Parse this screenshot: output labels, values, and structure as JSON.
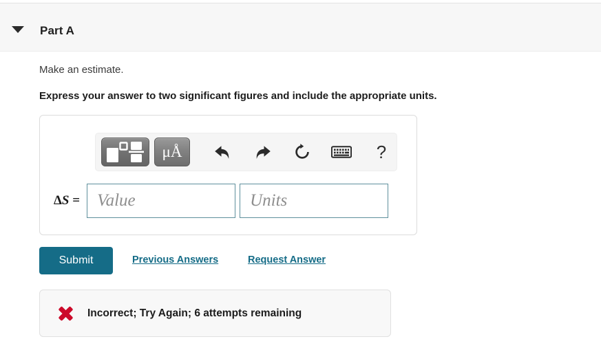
{
  "part": {
    "title": "Part A",
    "disclosure_icon": "caret-down-icon",
    "expanded": true
  },
  "question": {
    "prompt": "Make an estimate.",
    "instruction": "Express your answer to two significant figures and include the appropriate units."
  },
  "toolbar": {
    "template_button": {
      "icon": "math-template-icon",
      "tooltip": "Templates"
    },
    "units_button": {
      "label": "μÅ",
      "icon": "units-icon"
    },
    "undo_button": {
      "icon": "undo-arrow-icon"
    },
    "redo_button": {
      "icon": "redo-arrow-icon"
    },
    "reset_button": {
      "icon": "reset-circular-arrow-icon"
    },
    "keyboard_button": {
      "icon": "keyboard-icon"
    },
    "help_button": {
      "label": "?",
      "icon": "question-mark-icon"
    }
  },
  "answer": {
    "variable_symbol": "ΔS",
    "equals_sign": "=",
    "value_field": {
      "value": "",
      "placeholder": "Value"
    },
    "units_field": {
      "value": "",
      "placeholder": "Units"
    }
  },
  "actions": {
    "submit_label": "Submit",
    "previous_answers_label": "Previous Answers",
    "request_answer_label": "Request Answer"
  },
  "feedback": {
    "icon": "red-x-icon",
    "message": "Incorrect; Try Again; 6 attempts remaining",
    "attempts_remaining": 6
  },
  "colors": {
    "accent_teal": "#156c87",
    "error_red": "#cc0a2a",
    "header_band": "#f7f7f7",
    "input_border": "#5e8f9c"
  }
}
